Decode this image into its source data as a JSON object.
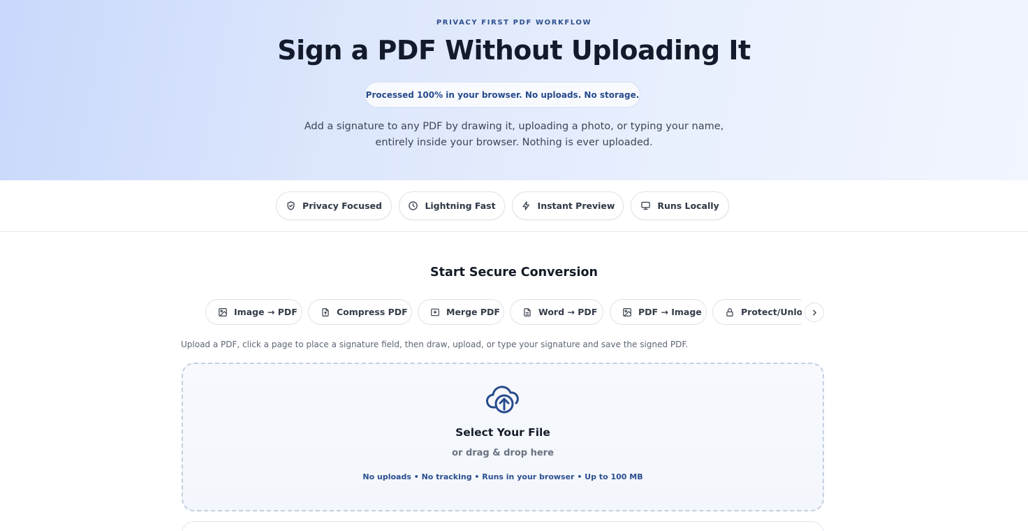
{
  "hero": {
    "eyebrow": "PRIVACY FIRST PDF WORKFLOW",
    "title": "Sign a PDF Without Uploading It",
    "notice": "Processed 100% in your browser. No uploads. No storage.",
    "subtitle_line1": "Add a signature to any PDF by drawing it, uploading a photo, or typing your name,",
    "subtitle_line2": "entirely inside your browser. Nothing is ever uploaded."
  },
  "features": [
    {
      "label": "Privacy Focused",
      "icon": "shield-check-icon"
    },
    {
      "label": "Lightning Fast",
      "icon": "clock-icon"
    },
    {
      "label": "Instant Preview",
      "icon": "lightning-icon"
    },
    {
      "label": "Runs Locally",
      "icon": "monitor-icon"
    }
  ],
  "converter": {
    "section_title": "Start Secure Conversion",
    "tabs": [
      {
        "label": "Image → PDF",
        "icon": "image-icon"
      },
      {
        "label": "Compress PDF",
        "icon": "file-compress-icon"
      },
      {
        "label": "Merge PDF",
        "icon": "merge-icon"
      },
      {
        "label": "Word → PDF",
        "icon": "document-icon"
      },
      {
        "label": "PDF → Image",
        "icon": "image-icon"
      },
      {
        "label": "Protect/Unlock",
        "icon": "lock-icon"
      }
    ],
    "next_icon": "chevron-right-icon",
    "instructions": "Upload a PDF, click a page to place a signature field, then draw, upload, or type your signature and save the signed PDF."
  },
  "dropzone": {
    "icon": "cloud-upload-icon",
    "title": "Select Your File",
    "subtitle": "or drag & drop here",
    "note": "No uploads • No tracking • Runs in your browser • Up to 100 MB"
  },
  "colors": {
    "accent": "#264a8c",
    "hero_start": "#c9d8fb",
    "hero_end": "#f1f5fe",
    "text_dark": "#121a2b"
  }
}
